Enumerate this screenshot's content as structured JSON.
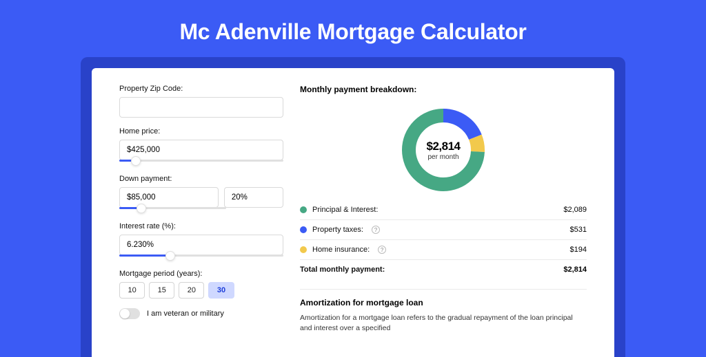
{
  "title": "Mc Adenville Mortgage Calculator",
  "colors": {
    "principal": "#46a884",
    "taxes": "#3b5bf5",
    "insurance": "#f2c94c"
  },
  "form": {
    "zip_label": "Property Zip Code:",
    "zip_value": "",
    "home_price_label": "Home price:",
    "home_price_value": "$425,000",
    "home_price_slider_pct": 10,
    "down_payment_label": "Down payment:",
    "down_payment_value": "$85,000",
    "down_payment_pct_value": "20%",
    "down_payment_slider_pct": 21,
    "interest_label": "Interest rate (%):",
    "interest_value": "6.230%",
    "interest_slider_pct": 31,
    "period_label": "Mortgage period (years):",
    "periods": [
      "10",
      "15",
      "20",
      "30"
    ],
    "period_selected": "30",
    "veteran_label": "I am veteran or military"
  },
  "breakdown": {
    "title": "Monthly payment breakdown:",
    "donut_amount": "$2,814",
    "donut_caption": "per month",
    "items": [
      {
        "label": "Principal & Interest:",
        "value": "$2,089",
        "color_key": "principal",
        "info": false
      },
      {
        "label": "Property taxes:",
        "value": "$531",
        "color_key": "taxes",
        "info": true
      },
      {
        "label": "Home insurance:",
        "value": "$194",
        "color_key": "insurance",
        "info": true
      }
    ],
    "total_label": "Total monthly payment:",
    "total_value": "$2,814"
  },
  "chart_data": {
    "type": "pie",
    "title": "Monthly payment breakdown",
    "series": [
      {
        "name": "Principal & Interest",
        "value": 2089,
        "color": "#46a884"
      },
      {
        "name": "Property taxes",
        "value": 531,
        "color": "#3b5bf5"
      },
      {
        "name": "Home insurance",
        "value": 194,
        "color": "#f2c94c"
      }
    ],
    "total": 2814,
    "unit": "USD per month"
  },
  "amortization": {
    "title": "Amortization for mortgage loan",
    "body": "Amortization for a mortgage loan refers to the gradual repayment of the loan principal and interest over a specified"
  }
}
